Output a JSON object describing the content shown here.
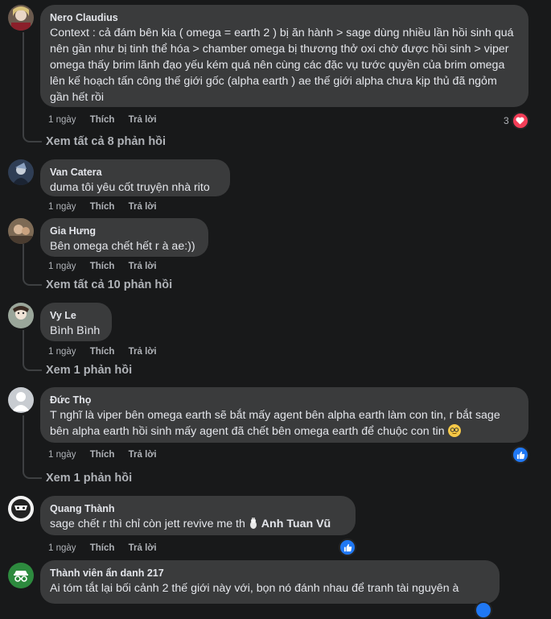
{
  "comments": [
    {
      "author": "Nero Claudius",
      "text": "Context : cả đám bên kia ( omega = earth 2 ) bị ăn hành > sage dùng nhiều lần hồi sinh quá nên gần như bị tinh thể hóa > chamber omega bị thương thở oxi chờ được hồi sinh > viper omega thấy brim lãnh đạo yếu kém quá nên cùng các đặc vụ tước quyền của brim omega lên kế hoạch tấn công thế giới gốc (alpha earth ) ae thế giới alpha chưa kịp thủ đã ngỏm gần hết rồi",
      "time": "1 ngày",
      "like": "Thích",
      "reply": "Trả lời",
      "reaction_count": "3",
      "reaction": "love"
    },
    {
      "author": "Van Catera",
      "text": "duma tôi yêu cốt truyện nhà rito",
      "time": "1 ngày",
      "like": "Thích",
      "reply": "Trả lời"
    },
    {
      "author": "Gia Hưng",
      "text": "Bên omega chết hết r à ae:))",
      "time": "1 ngày",
      "like": "Thích",
      "reply": "Trả lời"
    },
    {
      "author": "Vy Le",
      "text": "Bình Bình",
      "time": "1 ngày",
      "like": "Thích",
      "reply": "Trả lời"
    },
    {
      "author": "Đức Thọ",
      "text": "T nghĩ là viper bên omega earth sẽ bắt mấy agent bên alpha earth làm con tin, r bắt sage bên alpha earth hồi sinh mấy agent đã chết bên omega earth để chuộc con tin",
      "time": "1 ngày",
      "like": "Thích",
      "reply": "Trả lời",
      "reaction": "like"
    },
    {
      "author": "Quang Thành",
      "text": "sage chết r thì chỉ còn jett revive me th",
      "tag": "Anh Tuan Vũ",
      "time": "1 ngày",
      "like": "Thích",
      "reply": "Trả lời",
      "reaction": "like"
    },
    {
      "author": "Thành viên ẩn danh 217",
      "text": "Ai tóm tắt lại bối cảnh 2 thế giới này với, bọn nó đánh nhau để tranh tài nguyên à"
    }
  ],
  "view_replies": [
    "Xem tất cả 8 phản hồi",
    "Xem tất cả 10 phản hồi",
    "Xem 1 phản hồi",
    "Xem 1 phản hồi"
  ],
  "colors": {
    "background": "#18191a",
    "bubble": "#3a3b3c",
    "love": "#f33e58",
    "like": "#2078f4"
  }
}
